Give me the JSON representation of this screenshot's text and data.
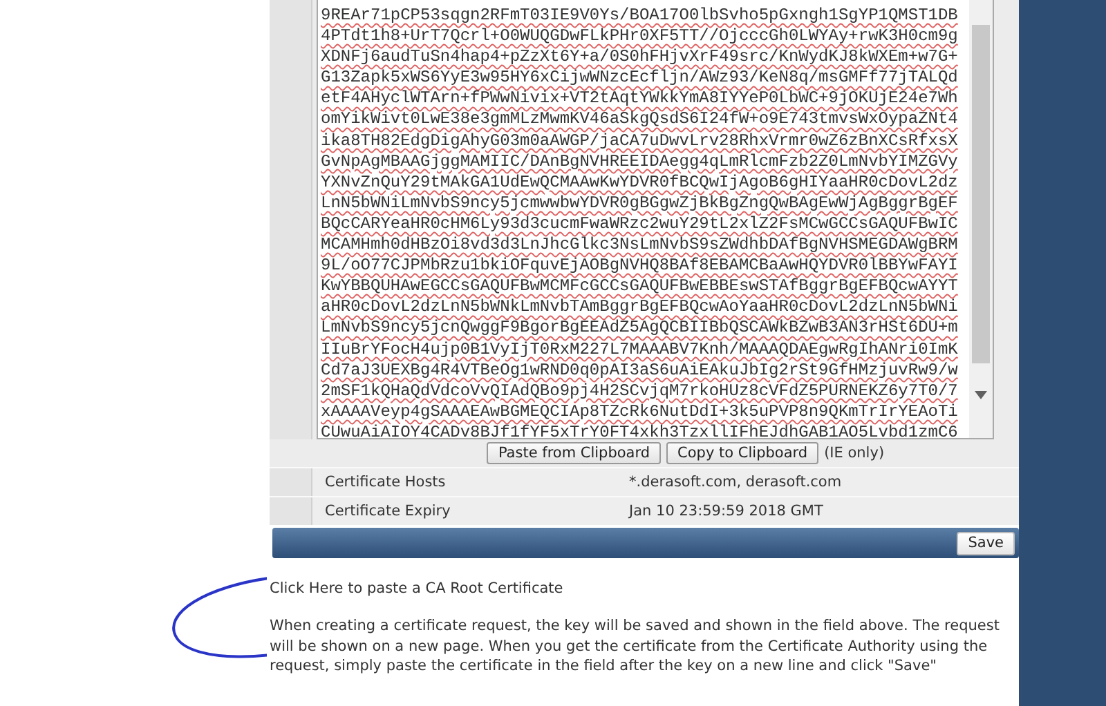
{
  "certificate_field": {
    "lines": [
      "9REAr71pCP53sqgn2RFmT03IE9V0Ys/BOA17O0lbSvho5pGxngh1SgYP1QMST1DB",
      "4PTdt1h8+UrT7Qcrl+O0WUQGDwFLkPHr0XF5TT//OjcccGh0LWYAy+rwK3H0cm9g",
      "XDNFj6audTuSn4hap4+pZzXt6Y+a/0S0hFHjvXrF49src/KnWydKJ8kWXEm+w7G+",
      "G13Zapk5xWS6YyE3w95HY6xCijwWNzcEcfljn/AWz93/KeN8q/msGMFf77jTALQd",
      "etF4AHyclWTArn+fPWwNivix+VT2tAqtYWkkYmA8IYYeP0LbWC+9jOKUjE24e7Wh",
      "omYikWivt0LwE38e3gmMLzMwmKV46aSkgQsdS6I24fW+o9E743tmvsWxOypaZNt4",
      "ika8TH82EdgDigAhyG03m0aAWGP/jaCA7uDwvLrv28RhxVrmr0wZ6zBnXCsRfxsX",
      "GvNpAgMBAAGjggMAMIIC/DAnBgNVHREEIDAegg4qLmRlcmFzb2Z0LmNvbYIMZGVy",
      "YXNvZnQuY29tMAkGA1UdEwQCMAAwKwYDVR0fBCQwIjAgoB6gHIYaaHR0cDovL2dz",
      "LnN5bWNiLmNvbS9ncy5jcmwwbwYDVR0gBGgwZjBkBgZngQwBAgEwWjAgBggrBgEF",
      "BQcCARYeaHR0cHM6Ly93d3cucmFwaWRzc2wuY29tL2xlZ2FsMCwGCCsGAQUFBwIC",
      "MCAMHmh0dHBzOi8vd3d3LnJhcGlkc3NsLmNvbS9sZWdhbDAfBgNVHSMEGDAWgBRM",
      "9L/oO77CJPMbRzu1bkiOFquvEjAOBgNVHQ8BAf8EBAMCBaAwHQYDVR0lBBYwFAYI",
      "KwYBBQUHAwEGCCsGAQUFBwMCMFcGCCsGAQUFBwEBBEswSTAfBggrBgEFBQcwAYYT",
      "aHR0cDovL2dzLnN5bWNkLmNvbTAmBggrBgEFBQcwAoYaaHR0cDovL2dzLnN5bWNi",
      "LmNvbS9ncy5jcnQwggF9BgorBgEEAdZ5AgQCBIIBbQSCAWkBZwB3AN3rHSt6DU+m",
      "IIuBrYFocH4ujp0B1VyIjT0RxM227L7MAAABV7Knh/MAAAQDAEgwRgIhANri0ImK",
      "Cd7aJ3UEXBg4R4VTBeOg1wRND0q0pAI3aS6uAiEAkuJbIg2rSt9GfHMzjuvRw9/w",
      "2mSF1kQHaQdVdcoVvQIAdQBo9pj4H2SCvjqM7rkoHUz8cVFdZ5PURNEKZ6y7T0/7",
      "xAAAAVeyp4gSAAAEAwBGMEQCIAp8TZcRk6NutDdI+3k5uPVP8n9QKmTrIrYEAoTi",
      "CUwuAiAIOY4CADv8BJf1fYF5xTrY0FT4xkh3TzxllIFhEJdhGAB1AO5Lvbd1zmC6"
    ]
  },
  "clipboard_buttons": [
    "Paste from Clipboard",
    "Copy to Clipboard"
  ],
  "clipboard_note": "(IE only)",
  "fields": [
    {
      "label": "Certificate Hosts",
      "value": "*.derasoft.com, derasoft.com"
    },
    {
      "label": "Certificate Expiry",
      "value": "Jan 10 23:59:59 2018 GMT"
    }
  ],
  "save_button": "Save",
  "root_link": "Click Here to paste a CA Root Certificate",
  "help_text": "When creating a certificate request, the key will be saved and shown in the field above. The request will be shown on a new page. When you get the certificate from the Certificate Authority using the request, simply paste the certificate in the field after the key on a new line and click \"Save\""
}
